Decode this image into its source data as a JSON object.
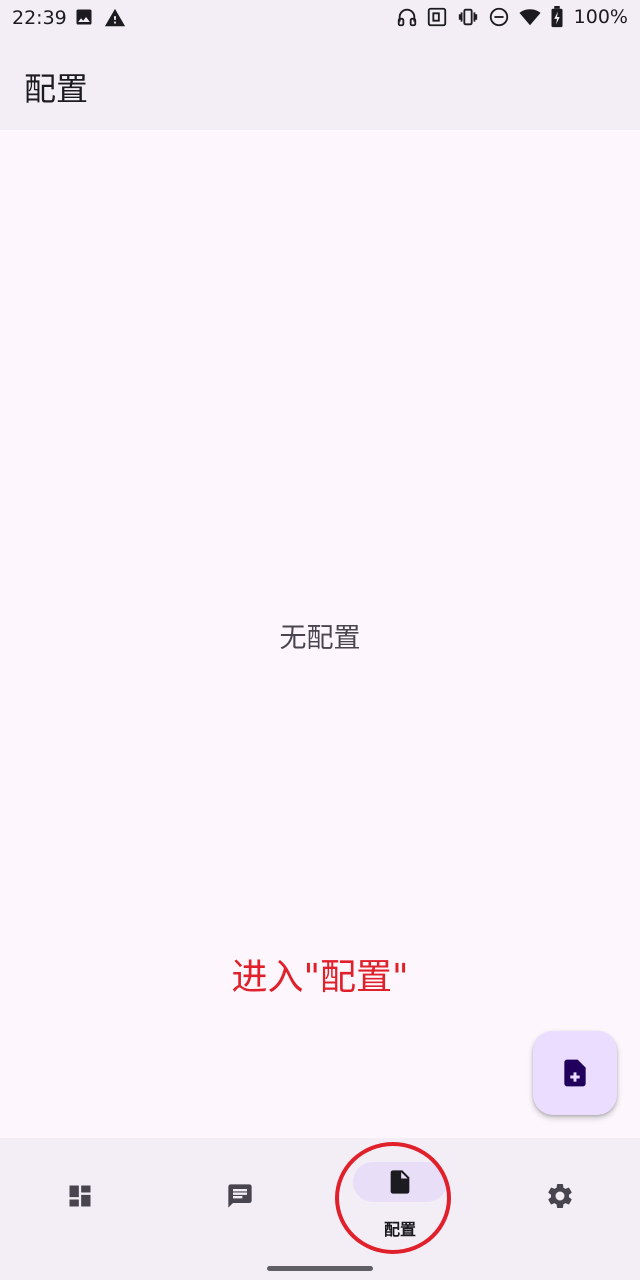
{
  "status_bar": {
    "time": "22:39",
    "left_icons": [
      "image-icon",
      "warning-icon"
    ],
    "right_icons": [
      "headphones-icon",
      "nfc-icon",
      "vibrate-icon",
      "do-not-disturb-icon",
      "wifi-icon",
      "battery-icon"
    ],
    "battery": "100%"
  },
  "app_bar": {
    "title": "配置"
  },
  "main": {
    "empty_text": "无配置"
  },
  "annotation": {
    "text": "进入\"配置\"",
    "color": "#e0202a"
  },
  "fab": {
    "icon": "add-file-icon"
  },
  "bottom_nav": {
    "items": [
      {
        "id": "dashboard",
        "icon": "dashboard-icon",
        "label": "",
        "active": false
      },
      {
        "id": "messages",
        "icon": "message-icon",
        "label": "",
        "active": false
      },
      {
        "id": "configs",
        "icon": "file-icon",
        "label": "配置",
        "active": true
      },
      {
        "id": "settings",
        "icon": "gear-icon",
        "label": "",
        "active": false
      }
    ]
  },
  "colors": {
    "background": "#fdf7fd",
    "bar": "#f3eef6",
    "accent_container": "#eaddff",
    "nav_indicator": "#e8def8",
    "text": "#1c1b1f",
    "muted_text": "#49454f",
    "annotation_red": "#e0202a"
  }
}
